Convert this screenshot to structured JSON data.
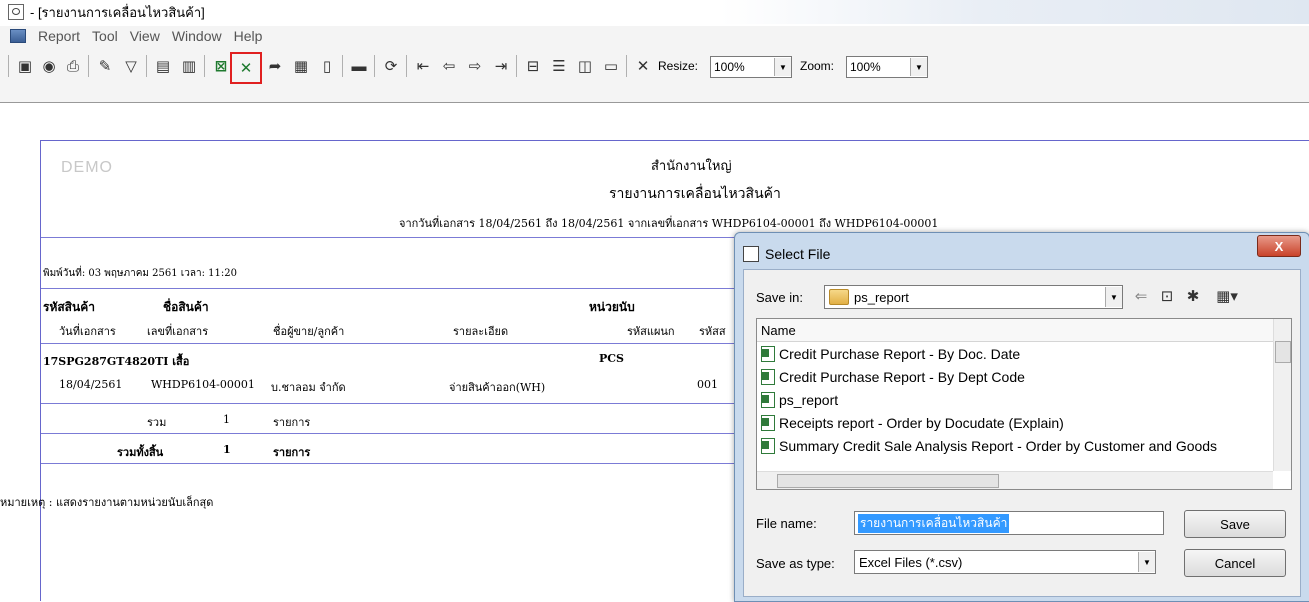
{
  "window": {
    "title": "- [รายงานการเคลื่อนไหวสินค้า]"
  },
  "menu": [
    "Report",
    "Tool",
    "View",
    "Window",
    "Help"
  ],
  "toolbar": {
    "resize_label": "Resize:",
    "resize_value": "100%",
    "zoom_label": "Zoom:",
    "zoom_value": "100%",
    "icons": [
      "report-setup-icon",
      "preview-icon",
      "print-icon",
      "edit-icon",
      "filter-icon",
      "save-icon",
      "export-icon",
      "excel-icon",
      "excel-export-icon",
      "arrow-tool-icon",
      "grid-icon",
      "page-icon",
      "calc-icon",
      "refresh-icon",
      "first-page-icon",
      "prev-page-icon",
      "next-page-icon",
      "last-page-icon",
      "layout1-icon",
      "layout2-icon",
      "layout3-icon",
      "layout4-icon",
      "close-icon"
    ]
  },
  "report": {
    "watermark": "DEMO",
    "company": "สำนักงานใหญ่",
    "title": "รายงานการเคลื่อนไหวสินค้า",
    "criteria": "จากวันที่เอกสาร 18/04/2561 ถึง 18/04/2561 จากเลขที่เอกสาร WHDP6104-00001 ถึง WHDP6104-00001",
    "print_date": "พิมพ์วันที่: 03 พฤษภาคม 2561 เวลา: 11:20",
    "headers": {
      "item_code": "รหัสสินค้า",
      "item_name": "ชื่อสินค้า",
      "unit": "หน่วยนับ",
      "doc_date": "วันที่เอกสาร",
      "doc_no": "เลขที่เอกสาร",
      "party": "ชื่อผู้ขาย/ลูกค้า",
      "detail": "รายละเอียด",
      "dept": "รหัสแผนก",
      "wh": "รหัสส"
    },
    "item_row": {
      "code": "17SPG287GT4820TI เสื้อ",
      "unit": "PCS"
    },
    "detail_row": {
      "date": "18/04/2561",
      "doc_no": "WHDP6104-00001",
      "party": "บ.ชาลอม จำกัด",
      "detail": "จ่ายสินค้าออก(WH)",
      "dept": "001"
    },
    "subtotal": {
      "label": "รวม",
      "count": "1",
      "unit": "รายการ"
    },
    "grand_total": {
      "label": "รวมทั้งสิ้น",
      "count": "1",
      "unit": "รายการ"
    },
    "note": "หมายเหตุ : แสดงรายงานตามหน่วยนับเล็กสุด"
  },
  "dialog": {
    "title": "Select File",
    "close_label": "X",
    "save_in_label": "Save in:",
    "save_in_value": "ps_report",
    "column_name": "Name",
    "files": [
      "Credit  Purchase  Report - By  Doc. Date",
      "Credit  Purchase  Report - By Dept Code",
      "ps_report",
      "Receipts report - Order by Docudate (Explain)",
      "Summary Credit Sale Analysis Report - Order by Customer and Goods"
    ],
    "file_name_label": "File name:",
    "file_name_value": "รายงานการเคลื่อนไหวสินค้า",
    "save_type_label": "Save as type:",
    "save_type_value": "Excel Files (*.csv)",
    "save_button": "Save",
    "cancel_button": "Cancel"
  }
}
